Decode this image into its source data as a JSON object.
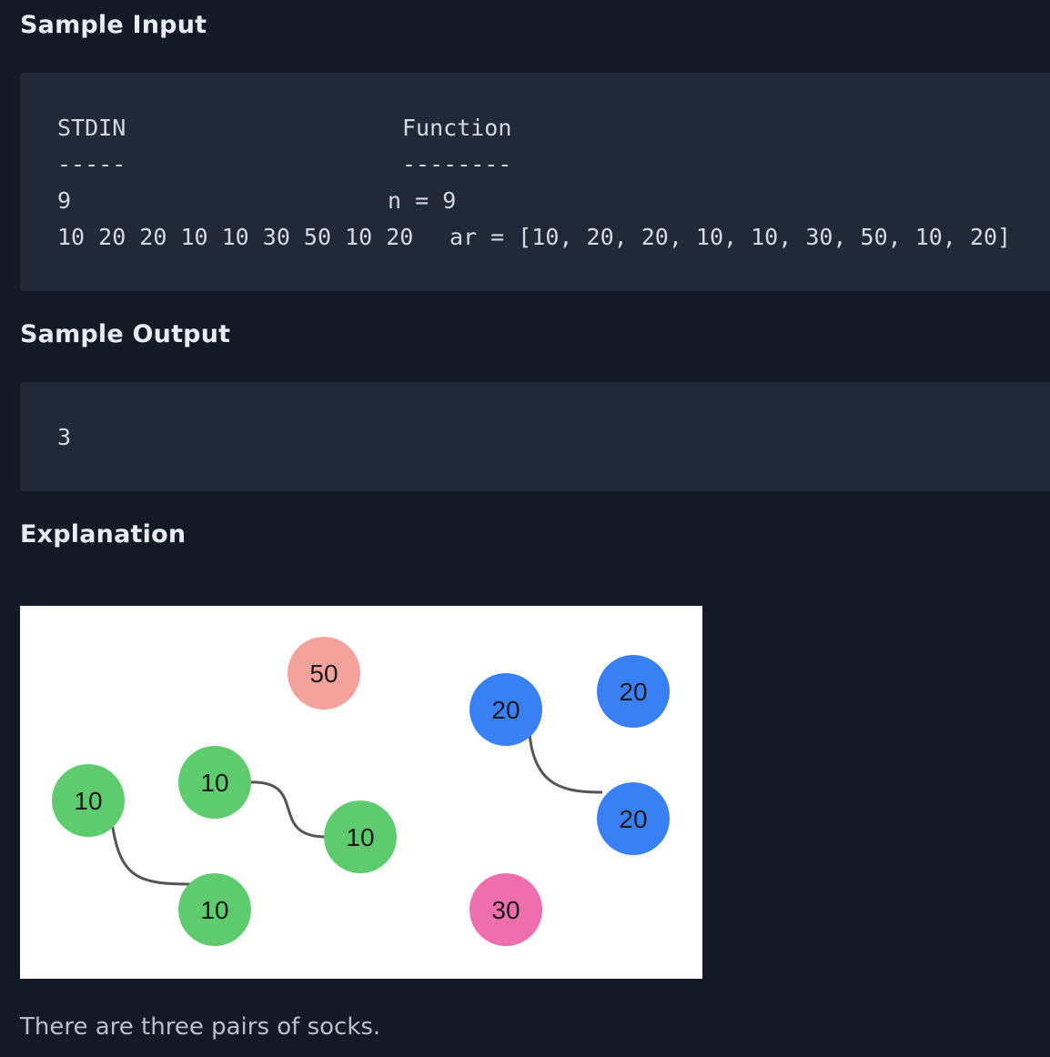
{
  "sample_input": {
    "heading": "Sample Input",
    "stdin_header": "STDIN",
    "function_header": "Function",
    "stdin_underline": "-----",
    "function_underline": "--------",
    "rows": [
      {
        "stdin": "9",
        "function": "n = 9"
      },
      {
        "stdin": "10 20 20 10 10 30 50 10 20",
        "function": "ar = [10, 20, 20, 10, 10, 30, 50, 10, 20]"
      }
    ]
  },
  "sample_output": {
    "heading": "Sample Output",
    "value": "3"
  },
  "explanation": {
    "heading": "Explanation",
    "text": "There are three pairs of socks.",
    "figure": {
      "colors": {
        "green": "#5ecb6f",
        "blue": "#3a80f5",
        "salmon": "#f4a29c",
        "pink": "#ef6fae",
        "link": "#555555"
      },
      "socks": [
        {
          "label": "10",
          "color": "green"
        },
        {
          "label": "10",
          "color": "green"
        },
        {
          "label": "10",
          "color": "green"
        },
        {
          "label": "10",
          "color": "green"
        },
        {
          "label": "50",
          "color": "salmon"
        },
        {
          "label": "20",
          "color": "blue"
        },
        {
          "label": "20",
          "color": "blue"
        },
        {
          "label": "20",
          "color": "blue"
        },
        {
          "label": "30",
          "color": "pink"
        }
      ]
    }
  }
}
